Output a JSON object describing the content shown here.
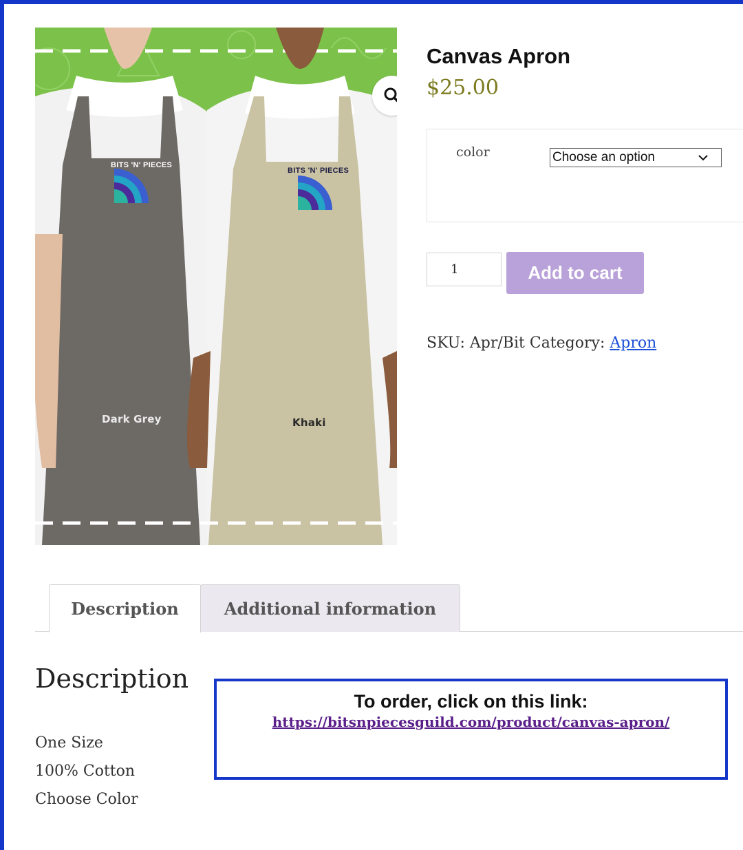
{
  "product": {
    "title": "Canvas Apron",
    "price": "$25.00",
    "image": {
      "logo_text": "BITS 'N' PIECES",
      "labels": [
        "Dark Grey",
        "Khaki"
      ]
    },
    "variation": {
      "label": "color",
      "selected": "Choose an option"
    },
    "quantity": "1",
    "add_to_cart_label": "Add to cart",
    "meta": {
      "sku_label": "SKU:",
      "sku_value": "Apr/Bit",
      "category_label": "Category:",
      "category_value": "Apron"
    }
  },
  "tabs": [
    {
      "label": "Description",
      "active": true
    },
    {
      "label": "Additional information",
      "active": false
    }
  ],
  "description": {
    "heading": "Description",
    "lines": [
      "One Size",
      "100% Cotton",
      "Choose Color"
    ]
  },
  "order_box": {
    "title": "To order, click on this link:",
    "link": "https://bitsnpiecesguild.com/product/canvas-apron/"
  },
  "colors": {
    "frame_border": "#1537c9",
    "price": "#7c7a1e",
    "add_to_cart": "#b9a2d9",
    "link": "#1c4fd8",
    "order_link": "#5b1f8a"
  },
  "icons": {
    "zoom": "magnifier-icon",
    "dropdown": "chevron-down-icon"
  }
}
